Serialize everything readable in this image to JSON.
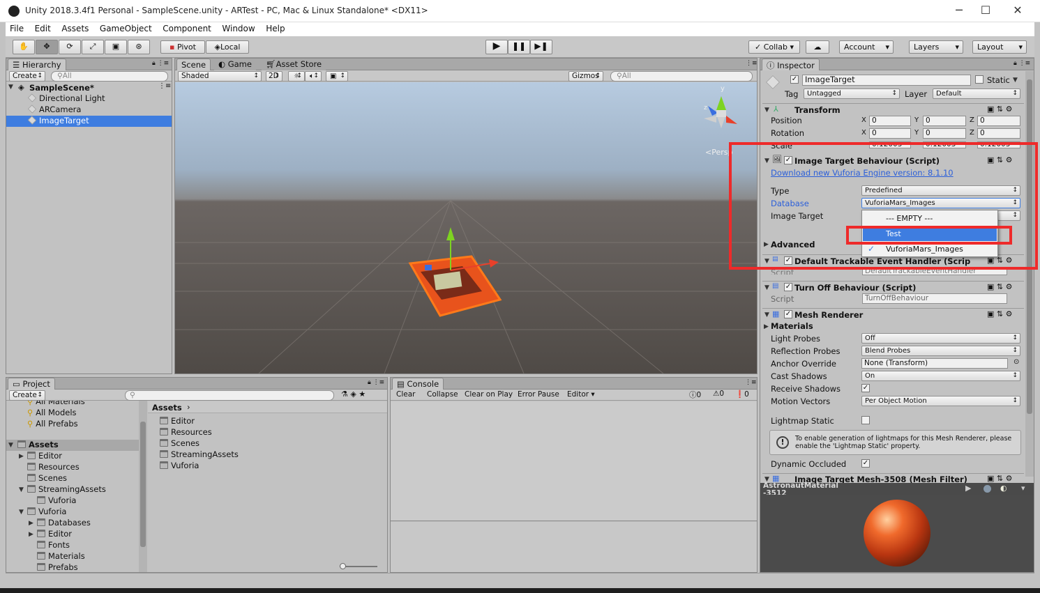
{
  "window": {
    "title": "Unity 2018.3.4f1 Personal - SampleScene.unity - ARTest - PC, Mac & Linux Standalone* <DX11>",
    "minimize": "─",
    "maximize": "☐",
    "close": "✕"
  },
  "menu": [
    "File",
    "Edit",
    "Assets",
    "GameObject",
    "Component",
    "Window",
    "Help"
  ],
  "toolbar": {
    "pivot": "Pivot",
    "local": "Local",
    "collab": "Collab",
    "account": "Account",
    "layers": "Layers",
    "layout": "Layout"
  },
  "hierarchy": {
    "tab": "Hierarchy",
    "create": "Create",
    "search_placeholder": "All",
    "scene": "SampleScene*",
    "items": [
      "Directional Light",
      "ARCamera",
      "ImageTarget"
    ]
  },
  "scene": {
    "tabs": [
      "Scene",
      "Game",
      "Asset Store"
    ],
    "shading": "Shaded",
    "mode2d": "2D",
    "gizmos": "Gizmos",
    "search_placeholder": "All",
    "persp": "Persp",
    "axis_y": "y",
    "axis_z": "z"
  },
  "inspector": {
    "tab": "Inspector",
    "object_name": "ImageTarget",
    "static_label": "Static",
    "tag_label": "Tag",
    "tag_value": "Untagged",
    "layer_label": "Layer",
    "layer_value": "Default",
    "transform": {
      "title": "Transform",
      "position": "Position",
      "rotation": "Rotation",
      "scale": "Scale",
      "pos": [
        "0",
        "0",
        "0"
      ],
      "rot": [
        "0",
        "0",
        "0"
      ],
      "scl": [
        "0.12003",
        "0.12003",
        "0.12003"
      ]
    },
    "itb": {
      "title": "Image Target Behaviour (Script)",
      "download": "Download new Vuforia Engine version: 8.1.10",
      "type_label": "Type",
      "type_value": "Predefined",
      "db_label": "Database",
      "db_value": "VuforiaMars_Images",
      "it_label": "Image Target",
      "advanced": "Advanced"
    },
    "dropdown": [
      "--- EMPTY ---",
      "Test",
      "VuforiaMars_Images"
    ],
    "dteh": {
      "title": "Default Trackable Event Handler (Scrip",
      "script_label": "Script",
      "script_value": "DefaultTrackableEventHandler"
    },
    "tob": {
      "title": "Turn Off Behaviour (Script)",
      "script_label": "Script",
      "script_value": "TurnOffBehaviour"
    },
    "mr": {
      "title": "Mesh Renderer",
      "materials": "Materials",
      "rows": [
        {
          "label": "Light Probes",
          "value": "Off"
        },
        {
          "label": "Reflection Probes",
          "value": "Blend Probes"
        },
        {
          "label": "Anchor Override",
          "value": "None (Transform)"
        },
        {
          "label": "Cast Shadows",
          "value": "On"
        }
      ],
      "receive_shadows": "Receive Shadows",
      "motion_vectors": "Motion Vectors",
      "motion_value": "Per Object Motion",
      "lightmap_static": "Lightmap Static",
      "help": "To enable generation of lightmaps for this Mesh Renderer, please enable the 'Lightmap Static' property.",
      "dynamic_occluded": "Dynamic Occluded"
    },
    "mf": {
      "title": "Image Target Mesh-3508 (Mesh Filter)"
    },
    "preview": {
      "title": "AstronautMaterial -3512"
    }
  },
  "project": {
    "tab": "Project",
    "create": "Create",
    "favorites": [
      "All Materials",
      "All Models",
      "All Prefabs"
    ],
    "tree": [
      {
        "name": "Assets",
        "indent": 0
      },
      {
        "name": "Editor",
        "indent": 1
      },
      {
        "name": "Resources",
        "indent": 1
      },
      {
        "name": "Scenes",
        "indent": 1
      },
      {
        "name": "StreamingAssets",
        "indent": 1
      },
      {
        "name": "Vuforia",
        "indent": 2
      },
      {
        "name": "Vuforia",
        "indent": 1
      },
      {
        "name": "Databases",
        "indent": 2
      },
      {
        "name": "Editor",
        "indent": 2
      },
      {
        "name": "Fonts",
        "indent": 2
      },
      {
        "name": "Materials",
        "indent": 2
      },
      {
        "name": "Prefabs",
        "indent": 2
      }
    ],
    "breadcrumb": "Assets",
    "files": [
      "Editor",
      "Resources",
      "Scenes",
      "StreamingAssets",
      "Vuforia"
    ]
  },
  "console": {
    "tab": "Console",
    "buttons": [
      "Clear",
      "Collapse",
      "Clear on Play",
      "Error Pause",
      "Editor"
    ],
    "counts": [
      "0",
      "0",
      "0"
    ]
  },
  "colors": {
    "selection": "#3e7de0",
    "highlight": "#ee2a2a",
    "link": "#2b5fd9"
  }
}
